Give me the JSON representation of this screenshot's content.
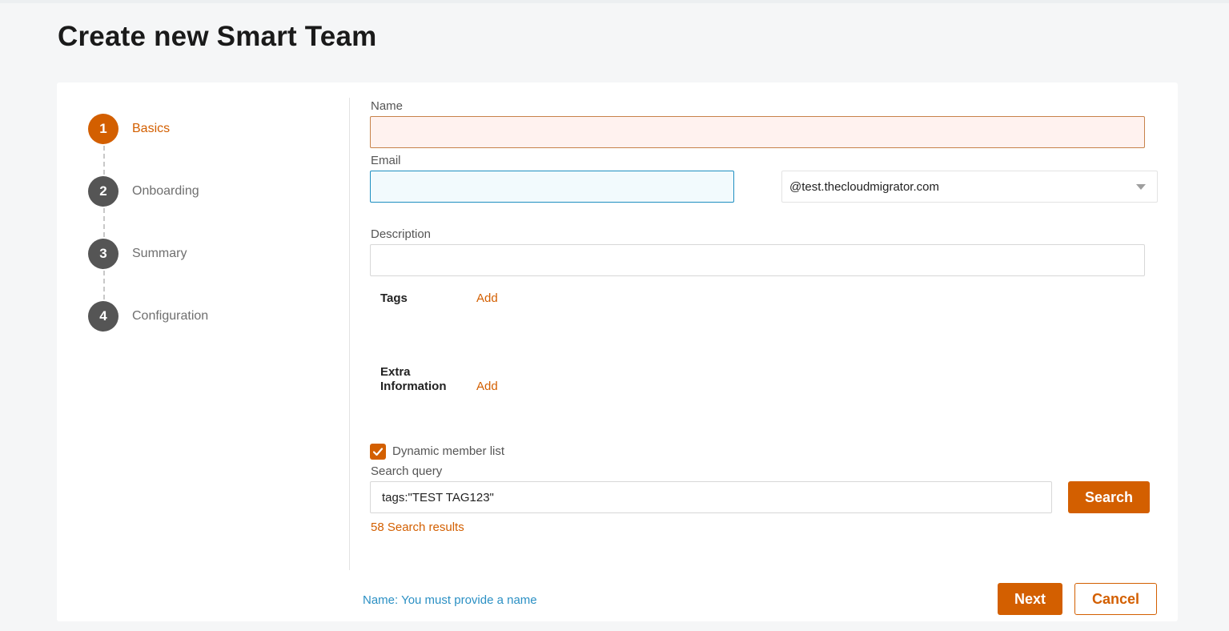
{
  "page": {
    "title": "Create new Smart Team"
  },
  "stepper": {
    "steps": [
      {
        "number": "1",
        "label": "Basics"
      },
      {
        "number": "2",
        "label": "Onboarding"
      },
      {
        "number": "3",
        "label": "Summary"
      },
      {
        "number": "4",
        "label": "Configuration"
      }
    ]
  },
  "form": {
    "name": {
      "label": "Name",
      "value": ""
    },
    "email": {
      "label": "Email",
      "value": "",
      "domain": "@test.thecloudmigrator.com"
    },
    "description": {
      "label": "Description",
      "value": ""
    },
    "tags": {
      "title": "Tags",
      "add_label": "Add"
    },
    "extra_info": {
      "title_line1": "Extra",
      "title_line2": "Information",
      "add_label": "Add"
    },
    "dynamic_member_list": {
      "label": "Dynamic member list",
      "checked": true
    },
    "search_query": {
      "label": "Search query",
      "value": "tags:\"TEST TAG123\"",
      "button_label": "Search"
    },
    "search_results": "58 Search results"
  },
  "footer": {
    "error_message": "Name: You must provide a name",
    "next_label": "Next",
    "cancel_label": "Cancel"
  },
  "colors": {
    "accent": "#d35f00",
    "step_inactive": "#555555",
    "error_link": "#2b90c4",
    "focus_border": "#1f8fc1"
  }
}
